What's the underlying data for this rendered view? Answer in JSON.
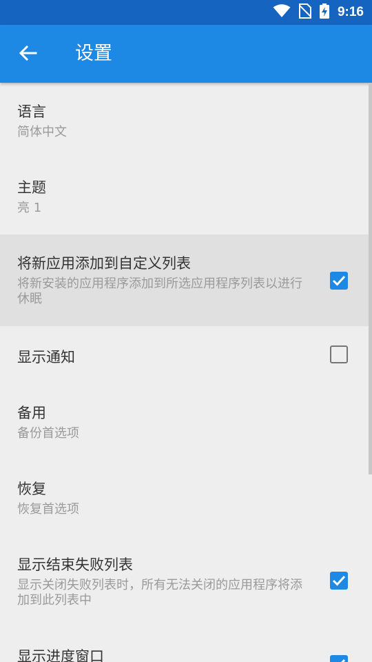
{
  "status_bar": {
    "time": "9:16",
    "icons": [
      "wifi-icon",
      "no-sim-icon",
      "battery-charging-icon"
    ]
  },
  "app_bar": {
    "title": "设置",
    "back_icon": "arrow-left-icon"
  },
  "colors": {
    "status_bar": "#1565c0",
    "app_bar": "#1e88e5",
    "accent": "#1e88e5",
    "background": "#eeeeee"
  },
  "settings": [
    {
      "title": "语言",
      "summary": "简体中文"
    },
    {
      "title": "主题",
      "summary": "亮 1"
    },
    {
      "title": "将新应用添加到自定义列表",
      "summary": "将新安装的应用程序添加到所选应用程序列表以进行休眠",
      "checked": true
    },
    {
      "title": "显示通知",
      "summary": "",
      "checked": false
    },
    {
      "title": "备用",
      "summary": "备份首选项"
    },
    {
      "title": "恢复",
      "summary": "恢复首选项"
    },
    {
      "title": "显示结束失败列表",
      "summary": "显示关闭失败列表时，所有无法关闭的应用程序将添加到此列表中",
      "checked": true
    },
    {
      "title": "显示进度窗口",
      "summary": "",
      "checked": true
    }
  ]
}
